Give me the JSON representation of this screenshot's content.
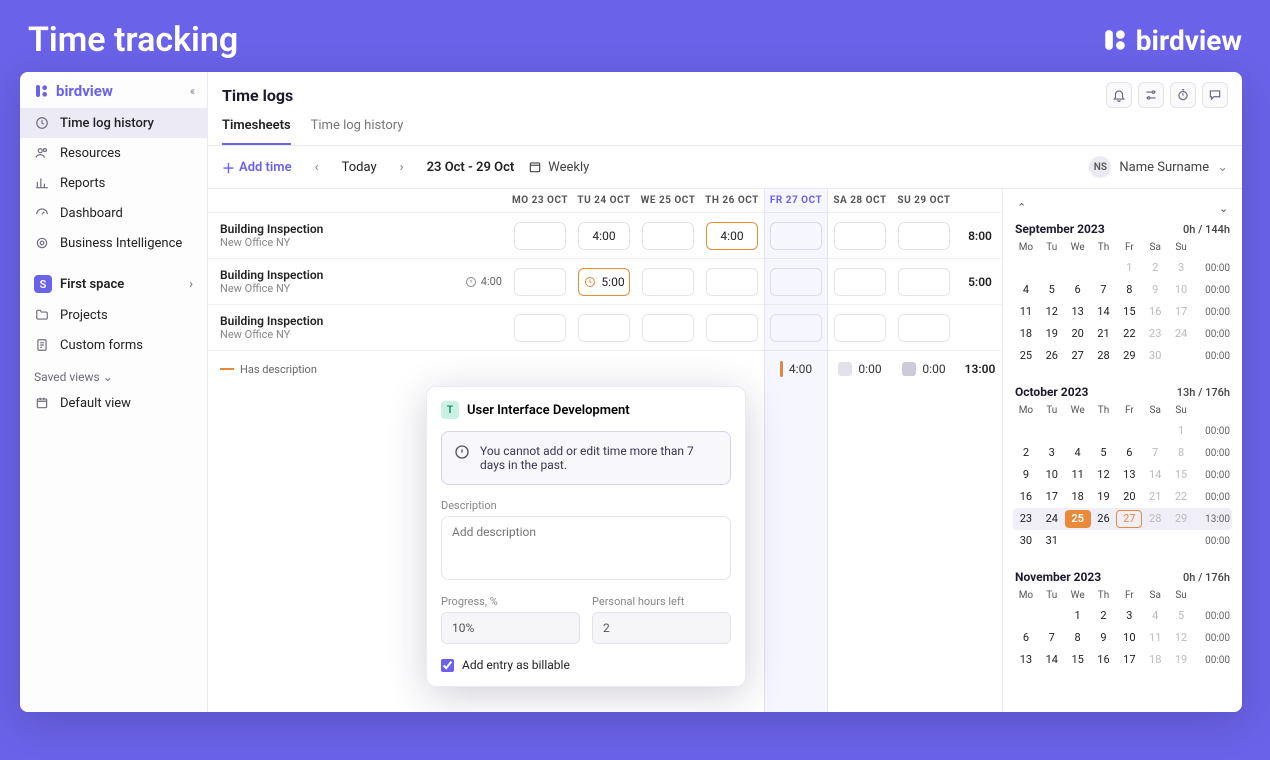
{
  "outer": {
    "title": "Time tracking",
    "brand": "birdview"
  },
  "sidebar": {
    "items": [
      {
        "label": "Time log history",
        "icon": "clock"
      },
      {
        "label": "Resources",
        "icon": "users"
      },
      {
        "label": "Reports",
        "icon": "bar"
      },
      {
        "label": "Dashboard",
        "icon": "gauge"
      },
      {
        "label": "Business Intelligence",
        "icon": "target"
      }
    ],
    "space": {
      "badge": "S",
      "label": "First space"
    },
    "space_items": [
      {
        "label": "Projects",
        "icon": "folder"
      },
      {
        "label": "Custom forms",
        "icon": "form"
      }
    ],
    "saved_views": "Saved views",
    "default_view": "Default view"
  },
  "header": {
    "title": "Time logs"
  },
  "tabs": {
    "timesheets": "Timesheets",
    "history": "Time log history"
  },
  "toolbar": {
    "add_time": "Add time",
    "today": "Today",
    "range": "23 Oct - 29 Oct",
    "weekly": "Weekly",
    "user_initials": "NS",
    "user_name": "Name Surname"
  },
  "days": [
    "MO 23 OCT",
    "TU 24 OCT",
    "WE 25 OCT",
    "TH 26 OCT",
    "FR 27 OCT",
    "SA 28 OCT",
    "SU 29 OCT"
  ],
  "rows": [
    {
      "name": "Building Inspection",
      "sub": "New Office NY",
      "cells": [
        "",
        "4:00",
        "",
        "4:00",
        "",
        "",
        ""
      ],
      "hl": 3,
      "total": "8:00"
    },
    {
      "name": "Building Inspection",
      "sub": "New Office NY",
      "info": "4:00",
      "cells": [
        "",
        "5:00",
        "",
        "",
        "",
        "",
        ""
      ],
      "hl": 1,
      "total": "5:00"
    },
    {
      "name": "Building Inspection",
      "sub": "New Office NY",
      "cells": [
        "",
        "",
        "",
        "",
        "",
        "",
        ""
      ],
      "total": ""
    }
  ],
  "footer": {
    "legend": "Has description",
    "f_fr_val": "4:00",
    "z1_color": "#e3e1ea",
    "z1_val": "0:00",
    "z2_color": "#cdcbd8",
    "z2_val": "0:00",
    "grand_total": "13:00"
  },
  "popup": {
    "title": "User Interface Development",
    "warning": "You cannot add or edit time more than 7 days in the past.",
    "desc_label": "Description",
    "desc_placeholder": "Add description",
    "prog_label": "Progress, %",
    "prog_value": "10%",
    "hours_label": "Personal hours left",
    "hours_value": "2",
    "billable": "Add entry as billable"
  },
  "calendar": {
    "months": [
      {
        "title": "September 2023",
        "stat": "0h / 144h",
        "weeks": [
          {
            "d": [
              "",
              "",
              "",
              "",
              "1",
              "2",
              "3"
            ],
            "mute": [
              4,
              5,
              6
            ],
            "tot": "00:00"
          },
          {
            "d": [
              "4",
              "5",
              "6",
              "7",
              "8",
              "9",
              "10"
            ],
            "mute": [
              5,
              6
            ],
            "tot": "00:00"
          },
          {
            "d": [
              "11",
              "12",
              "13",
              "14",
              "15",
              "16",
              "17"
            ],
            "mute": [
              5,
              6
            ],
            "tot": "00:00"
          },
          {
            "d": [
              "18",
              "19",
              "20",
              "21",
              "22",
              "23",
              "24"
            ],
            "mute": [
              5,
              6
            ],
            "tot": "00:00"
          },
          {
            "d": [
              "25",
              "26",
              "27",
              "28",
              "29",
              "30",
              ""
            ],
            "mute": [
              5
            ],
            "tot": "00:00"
          }
        ]
      },
      {
        "title": "October 2023",
        "stat": "13h / 176h",
        "weeks": [
          {
            "d": [
              "",
              "",
              "",
              "",
              "",
              "",
              "1"
            ],
            "mute": [
              6
            ],
            "tot": "00:00"
          },
          {
            "d": [
              "2",
              "3",
              "4",
              "5",
              "6",
              "7",
              "8"
            ],
            "mute": [
              5,
              6
            ],
            "tot": "00:00"
          },
          {
            "d": [
              "9",
              "10",
              "11",
              "12",
              "13",
              "14",
              "15"
            ],
            "mute": [
              5,
              6
            ],
            "tot": "00:00"
          },
          {
            "d": [
              "16",
              "17",
              "18",
              "19",
              "20",
              "21",
              "22"
            ],
            "mute": [
              5,
              6
            ],
            "tot": "00:00"
          },
          {
            "d": [
              "23",
              "24",
              "25",
              "26",
              "27",
              "28",
              "29"
            ],
            "mute": [
              5,
              6
            ],
            "tot": "13:00",
            "hl": true,
            "sel": 2,
            "outline": 4
          },
          {
            "d": [
              "30",
              "31",
              "",
              "",
              "",
              "",
              ""
            ],
            "tot": "00:00"
          }
        ]
      },
      {
        "title": "November 2023",
        "stat": "0h / 176h",
        "weeks": [
          {
            "d": [
              "",
              "",
              "1",
              "2",
              "3",
              "4",
              "5"
            ],
            "mute": [
              5,
              6
            ],
            "tot": "00:00"
          },
          {
            "d": [
              "6",
              "7",
              "8",
              "9",
              "10",
              "11",
              "12"
            ],
            "mute": [
              5,
              6
            ],
            "tot": "00:00"
          },
          {
            "d": [
              "13",
              "14",
              "15",
              "16",
              "17",
              "18",
              "19"
            ],
            "mute": [
              5,
              6
            ],
            "tot": "00:00"
          }
        ]
      }
    ],
    "dow": [
      "Mo",
      "Tu",
      "We",
      "Th",
      "Fr",
      "Sa",
      "Su"
    ]
  }
}
